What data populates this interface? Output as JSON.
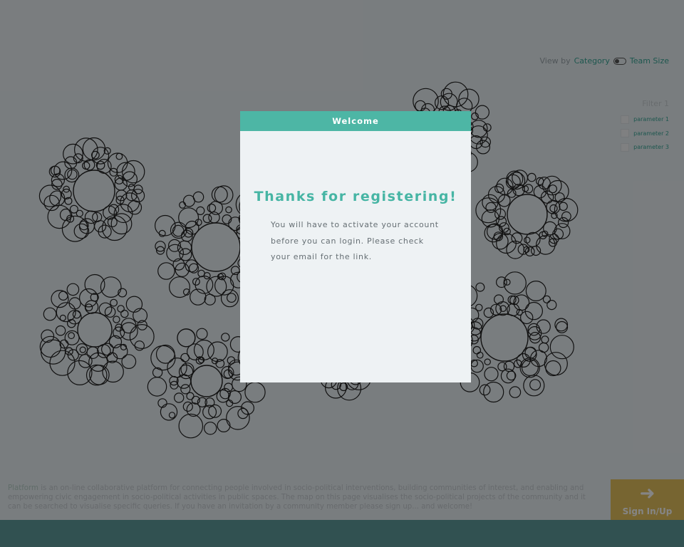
{
  "view_by": {
    "label": "View by",
    "option_category": "Category",
    "option_team_size": "Team Size"
  },
  "filter": {
    "title": "Filter 1",
    "params": [
      {
        "label": "parameter 1"
      },
      {
        "label": "parameter 2"
      },
      {
        "label": "parameter 3"
      }
    ]
  },
  "footer": {
    "brand": "Platform",
    "description": " is an on-line collaborative platform for connecting people involved in socio-political interventions, building communities of interest, and enabling and empowering civic engagement in socio-political activities in public spaces. The map on this page visualises the socio-political projects of the community and it can be searched to visualise specific queries. If you have an invitation by a community member please sign up... and welcome!",
    "signin_label": "Sign In/Up",
    "signin_icon": "arrow-right-icon"
  },
  "modal": {
    "header": "Welcome",
    "heading": "Thanks for registering!",
    "body": "You will have to activate your account before you can login. Please check your email for the link."
  },
  "colors": {
    "accent": "#4db6a5",
    "signin": "#e4c25f",
    "bottombar": "#5f9c9b",
    "background": "#e9eff3"
  }
}
